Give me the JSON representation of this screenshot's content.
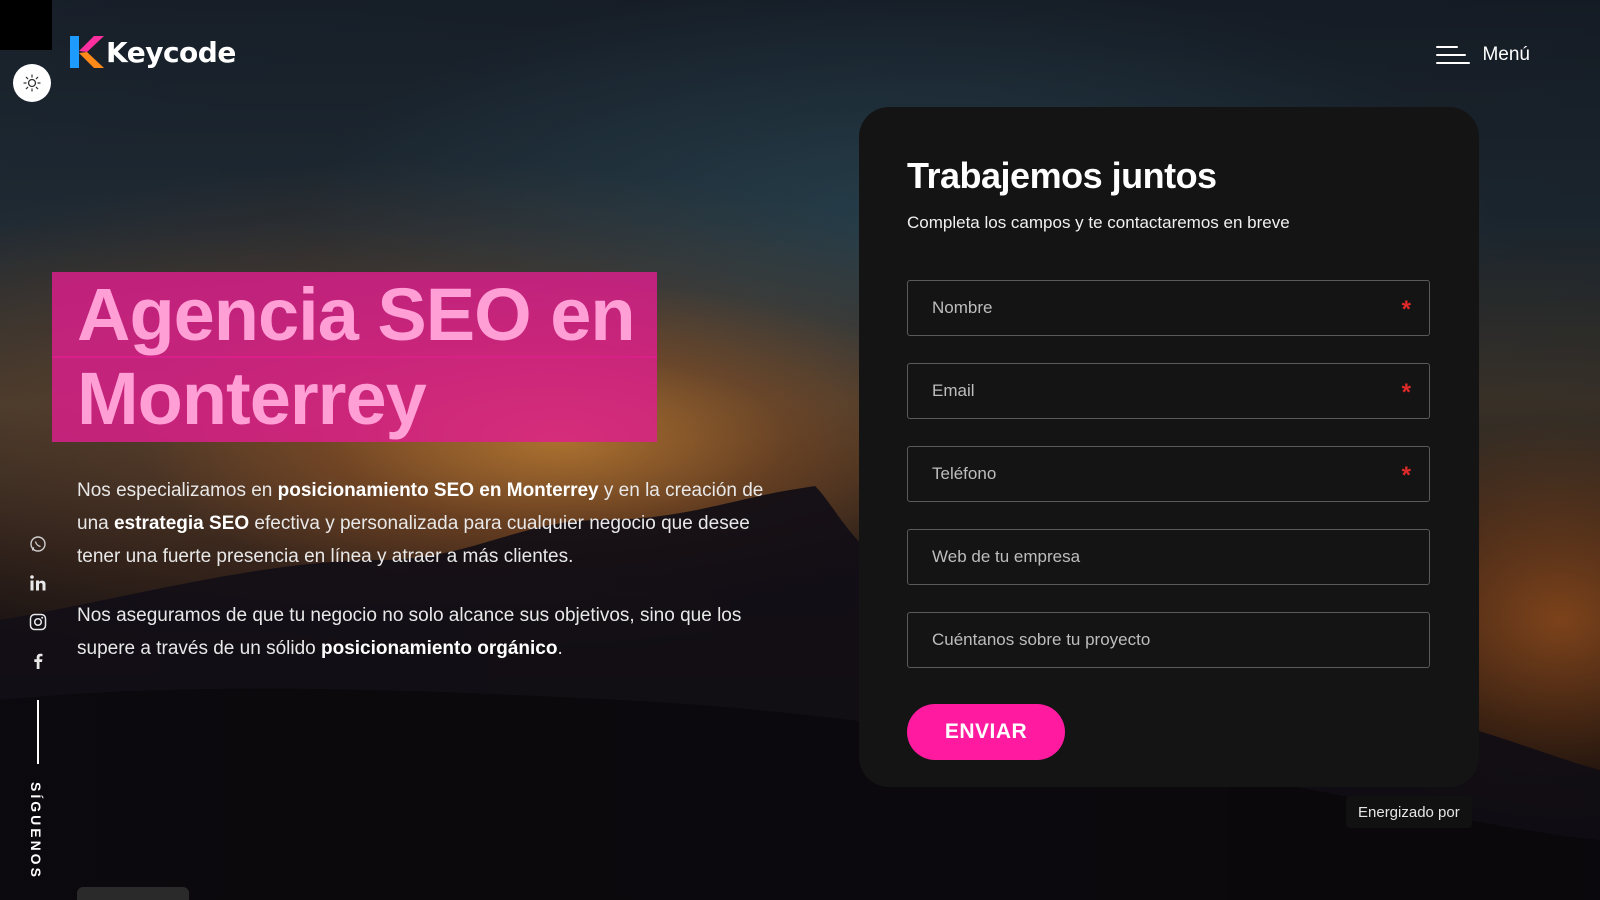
{
  "brand": {
    "name": "Keycode",
    "accent": "#ff1aa0"
  },
  "header": {
    "menu_label": "Menú",
    "theme_toggle_icon": "sun-icon"
  },
  "hero": {
    "title_line1": "Agencia SEO en",
    "title_line2": "Monterrey",
    "p1_a": "Nos especializamos en ",
    "p1_b": "posicionamiento SEO en Monterrey",
    "p1_c": " y en la creación de una ",
    "p1_d": "estrategia SEO",
    "p1_e": " efectiva y personalizada para cualquier negocio que desee tener una fuerte presencia en línea y atraer a más clientes.",
    "p2_a": "Nos aseguramos de que tu negocio no solo alcance sus objetivos, sino que los supere a través de un sólido ",
    "p2_b": "posicionamiento orgánico",
    "p2_c": "."
  },
  "social": {
    "icons": [
      "whatsapp-icon",
      "linkedin-icon",
      "instagram-icon",
      "facebook-icon"
    ],
    "follow_label": "SÍGUENOS"
  },
  "form": {
    "title": "Trabajemos juntos",
    "subtitle": "Completa los campos y te contactaremos en breve",
    "fields": [
      {
        "placeholder": "Nombre",
        "required": true
      },
      {
        "placeholder": "Email",
        "required": true
      },
      {
        "placeholder": "Teléfono",
        "required": true
      },
      {
        "placeholder": "Web de tu empresa",
        "required": false
      },
      {
        "placeholder": "Cuéntanos sobre tu proyecto",
        "required": false
      }
    ],
    "required_mark": "*",
    "submit_label": "ENVIAR"
  },
  "footer": {
    "powered_by": "Energizado por"
  }
}
